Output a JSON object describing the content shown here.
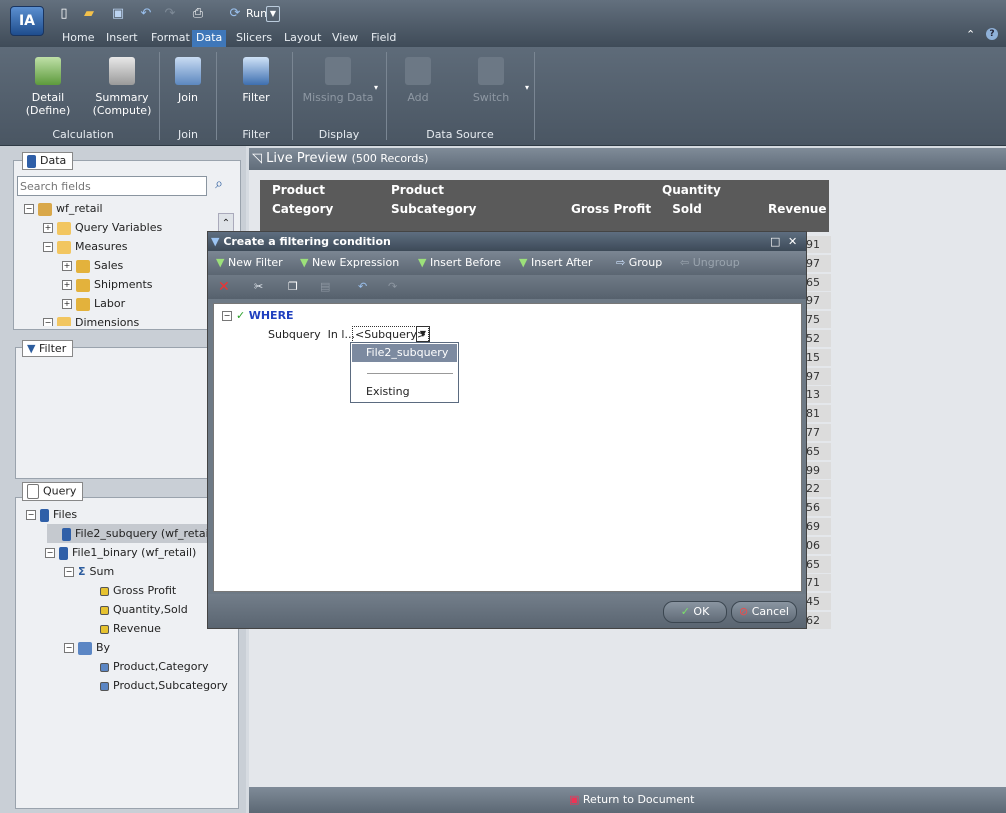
{
  "app": {
    "logo": "IA",
    "run_label": "Run"
  },
  "tabs": [
    "Home",
    "Insert",
    "Format",
    "Data",
    "Slicers",
    "Layout",
    "View",
    "Field"
  ],
  "active_tab": "Data",
  "ribbon": {
    "buttons": {
      "detail": "Detail\n(Define)",
      "summary": "Summary\n(Compute)",
      "join": "Join",
      "filter": "Filter",
      "missing": "Missing Data",
      "add": "Add",
      "switch": "Switch"
    },
    "groups": {
      "calculation": "Calculation",
      "join": "Join",
      "filter": "Filter",
      "display": "Display",
      "datasource": "Data Source"
    }
  },
  "data_panel": {
    "title": "Data",
    "search_placeholder": "Search fields",
    "tree": {
      "root": "wf_retail",
      "query_variables": "Query Variables",
      "measures": "Measures",
      "sales": "Sales",
      "shipments": "Shipments",
      "labor": "Labor",
      "dimensions": "Dimensions"
    }
  },
  "filter_panel": {
    "title": "Filter"
  },
  "query_panel": {
    "title": "Query",
    "files": "Files",
    "file2": "File2_subquery (wf_retail)",
    "file1": "File1_binary (wf_retail)",
    "sum": "Sum",
    "gross_profit": "Gross Profit",
    "quantity_sold": "Quantity,Sold",
    "revenue": "Revenue",
    "by": "By",
    "product_category": "Product,Category",
    "product_subcategory": "Product,Subcategory"
  },
  "live_preview": {
    "title": "Live Preview",
    "records": "(500 Records)"
  },
  "report": {
    "headers": {
      "product_category_1": "Product",
      "product_category_2": "Category",
      "product_subcategory_1": "Product",
      "product_subcategory_2": "Subcategory",
      "gross_profit": "Gross Profit",
      "quantity_1": "Quantity",
      "quantity_2": "Sold",
      "revenue": "Revenue"
    },
    "revenue_fragments": [
      "91",
      "97",
      "65",
      "97",
      "75",
      "52",
      "15",
      "97",
      "13",
      "81",
      "77",
      "65",
      "99",
      "22",
      "56",
      "69",
      "06",
      "65",
      "71",
      "45",
      "62"
    ]
  },
  "return_label": "Return to Document",
  "dialog": {
    "title": "Create a filtering condition",
    "toolbar": {
      "new_filter": "New Filter",
      "new_expression": "New Expression",
      "insert_before": "Insert Before",
      "insert_after": "Insert After",
      "group": "Group",
      "ungroup": "Ungroup"
    },
    "where": "WHERE",
    "condition_label": "Subquery  In l...",
    "subquery_value": "<Subquery>",
    "dropdown_options": [
      "File2_subquery",
      "Existing"
    ],
    "ok": "OK",
    "cancel": "Cancel"
  },
  "colors": {
    "accent": "#3f77b9",
    "ribbon": "#556170",
    "report_header": "#5a5a5a"
  }
}
